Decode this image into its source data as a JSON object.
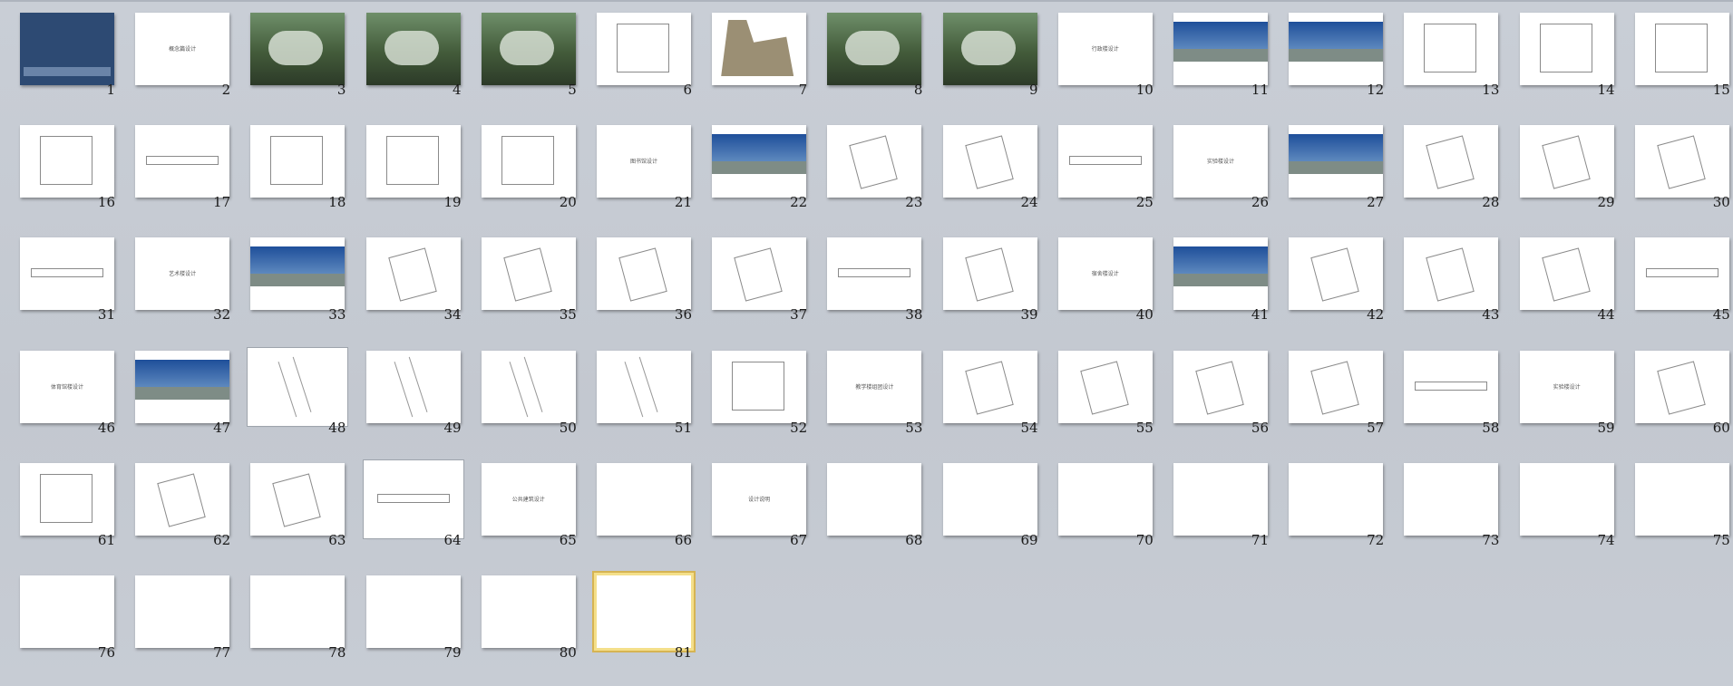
{
  "slides": [
    {
      "number": "1",
      "kind": "cover",
      "title": ""
    },
    {
      "number": "2",
      "kind": "title",
      "title": "概念篇设计"
    },
    {
      "number": "3",
      "kind": "aerial",
      "title": ""
    },
    {
      "number": "4",
      "kind": "aerial",
      "title": ""
    },
    {
      "number": "5",
      "kind": "aerial",
      "title": ""
    },
    {
      "number": "6",
      "kind": "plan",
      "title": ""
    },
    {
      "number": "7",
      "kind": "site",
      "title": ""
    },
    {
      "number": "8",
      "kind": "aerial",
      "title": ""
    },
    {
      "number": "9",
      "kind": "aerial",
      "title": ""
    },
    {
      "number": "10",
      "kind": "title",
      "title": "行政楼设计"
    },
    {
      "number": "11",
      "kind": "photo",
      "title": ""
    },
    {
      "number": "12",
      "kind": "photo",
      "title": ""
    },
    {
      "number": "13",
      "kind": "plan",
      "title": ""
    },
    {
      "number": "14",
      "kind": "plan",
      "title": ""
    },
    {
      "number": "15",
      "kind": "plan",
      "title": ""
    },
    {
      "number": "16",
      "kind": "plan",
      "title": ""
    },
    {
      "number": "17",
      "kind": "strip",
      "title": ""
    },
    {
      "number": "18",
      "kind": "plan",
      "title": ""
    },
    {
      "number": "19",
      "kind": "plan",
      "title": ""
    },
    {
      "number": "20",
      "kind": "plan",
      "title": ""
    },
    {
      "number": "21",
      "kind": "title",
      "title": "图书馆设计"
    },
    {
      "number": "22",
      "kind": "photo",
      "title": ""
    },
    {
      "number": "23",
      "kind": "plan2",
      "title": ""
    },
    {
      "number": "24",
      "kind": "plan2",
      "title": ""
    },
    {
      "number": "25",
      "kind": "strip",
      "title": ""
    },
    {
      "number": "26",
      "kind": "title",
      "title": "实验楼设计"
    },
    {
      "number": "27",
      "kind": "photo",
      "title": ""
    },
    {
      "number": "28",
      "kind": "plan2",
      "title": ""
    },
    {
      "number": "29",
      "kind": "plan2",
      "title": ""
    },
    {
      "number": "30",
      "kind": "plan2",
      "title": ""
    },
    {
      "number": "31",
      "kind": "strip",
      "title": ""
    },
    {
      "number": "32",
      "kind": "title",
      "title": "艺术楼设计"
    },
    {
      "number": "33",
      "kind": "photo",
      "title": ""
    },
    {
      "number": "34",
      "kind": "plan2",
      "title": ""
    },
    {
      "number": "35",
      "kind": "plan2",
      "title": ""
    },
    {
      "number": "36",
      "kind": "plan2",
      "title": ""
    },
    {
      "number": "37",
      "kind": "plan2",
      "title": ""
    },
    {
      "number": "38",
      "kind": "strip",
      "title": ""
    },
    {
      "number": "39",
      "kind": "plan2",
      "title": ""
    },
    {
      "number": "40",
      "kind": "title",
      "title": "宿舍楼设计"
    },
    {
      "number": "41",
      "kind": "photo",
      "title": ""
    },
    {
      "number": "42",
      "kind": "plan2",
      "title": ""
    },
    {
      "number": "43",
      "kind": "plan2",
      "title": ""
    },
    {
      "number": "44",
      "kind": "plan2",
      "title": ""
    },
    {
      "number": "45",
      "kind": "strip",
      "title": ""
    },
    {
      "number": "46",
      "kind": "title",
      "title": "体育馆楼设计"
    },
    {
      "number": "47",
      "kind": "photo",
      "title": ""
    },
    {
      "number": "48",
      "kind": "diag",
      "title": ""
    },
    {
      "number": "49",
      "kind": "diag",
      "title": ""
    },
    {
      "number": "50",
      "kind": "diag",
      "title": ""
    },
    {
      "number": "51",
      "kind": "diag",
      "title": ""
    },
    {
      "number": "52",
      "kind": "plan",
      "title": ""
    },
    {
      "number": "53",
      "kind": "title",
      "title": "教学楼组团设计"
    },
    {
      "number": "54",
      "kind": "plan2",
      "title": ""
    },
    {
      "number": "55",
      "kind": "plan2",
      "title": ""
    },
    {
      "number": "56",
      "kind": "plan2",
      "title": ""
    },
    {
      "number": "57",
      "kind": "plan2",
      "title": ""
    },
    {
      "number": "58",
      "kind": "strip",
      "title": ""
    },
    {
      "number": "59",
      "kind": "title",
      "title": "实验楼设计"
    },
    {
      "number": "60",
      "kind": "plan2",
      "title": ""
    },
    {
      "number": "61",
      "kind": "plan",
      "title": ""
    },
    {
      "number": "62",
      "kind": "plan2",
      "title": ""
    },
    {
      "number": "63",
      "kind": "plan2",
      "title": ""
    },
    {
      "number": "64",
      "kind": "strip",
      "title": ""
    },
    {
      "number": "65",
      "kind": "title",
      "title": "公共建筑设计"
    },
    {
      "number": "66",
      "kind": "blank",
      "title": ""
    },
    {
      "number": "67",
      "kind": "title",
      "title": "设计说明"
    },
    {
      "number": "68",
      "kind": "blank",
      "title": ""
    },
    {
      "number": "69",
      "kind": "blank",
      "title": ""
    },
    {
      "number": "70",
      "kind": "blank",
      "title": ""
    },
    {
      "number": "71",
      "kind": "blank",
      "title": ""
    },
    {
      "number": "72",
      "kind": "blank",
      "title": ""
    },
    {
      "number": "73",
      "kind": "blank",
      "title": ""
    },
    {
      "number": "74",
      "kind": "blank",
      "title": ""
    },
    {
      "number": "75",
      "kind": "blank",
      "title": ""
    },
    {
      "number": "76",
      "kind": "blank",
      "title": ""
    },
    {
      "number": "77",
      "kind": "blank",
      "title": ""
    },
    {
      "number": "78",
      "kind": "blank",
      "title": ""
    },
    {
      "number": "79",
      "kind": "blank",
      "title": ""
    },
    {
      "number": "80",
      "kind": "blank",
      "title": ""
    },
    {
      "number": "81",
      "kind": "blank",
      "title": ""
    }
  ],
  "selected_slide": "81",
  "hover_slides": [
    "48",
    "64"
  ]
}
